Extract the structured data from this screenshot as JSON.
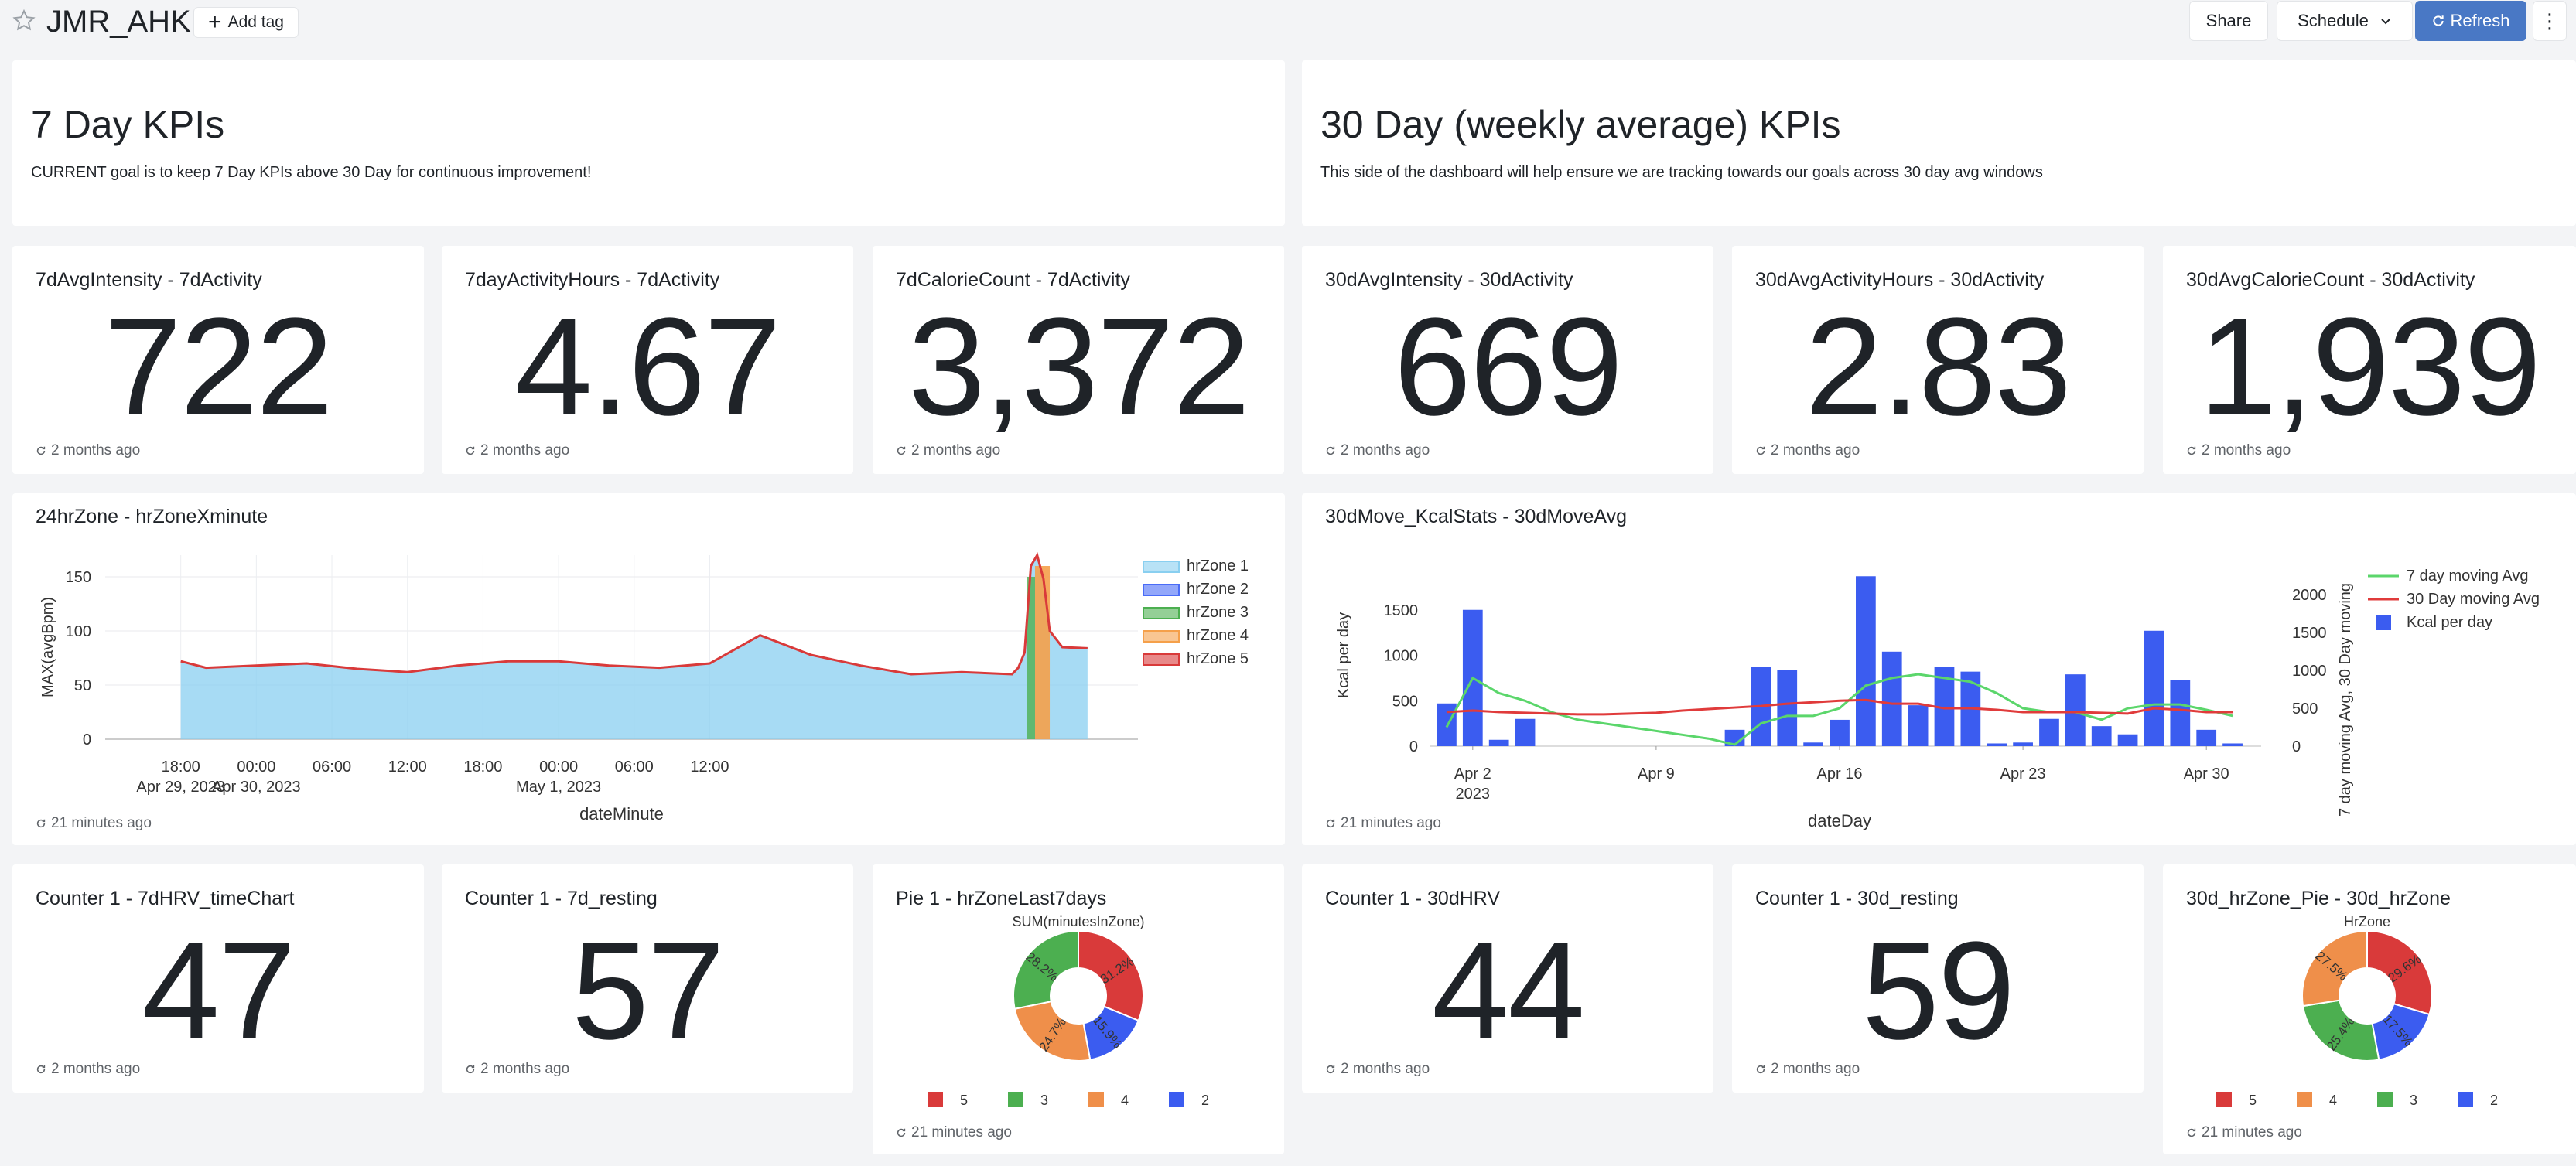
{
  "header": {
    "title": "JMR_AHK",
    "add_tag": "Add tag",
    "share": "Share",
    "schedule": "Schedule",
    "refresh": "Refresh"
  },
  "sections": [
    {
      "title": "7 Day KPIs",
      "subtitle": "CURRENT goal is to keep 7 Day KPIs above 30 Day for continuous improvement!"
    },
    {
      "title": "30 Day (weekly average) KPIs",
      "subtitle": "This side of the dashboard will help ensure we are tracking towards our goals across 30 day avg windows"
    }
  ],
  "counters_top": [
    {
      "title": "7dAvgIntensity - 7dActivity",
      "value": "722",
      "updated": "2 months ago"
    },
    {
      "title": "7dayActivityHours - 7dActivity",
      "value": "4.67",
      "updated": "2 months ago"
    },
    {
      "title": "7dCalorieCount - 7dActivity",
      "value": "3,372",
      "updated": "2 months ago"
    },
    {
      "title": "30dAvgIntensity - 30dActivity",
      "value": "669",
      "updated": "2 months ago"
    },
    {
      "title": "30dAvgActivityHours - 30dActivity",
      "value": "2.83",
      "updated": "2 months ago"
    },
    {
      "title": "30dAvgCalorieCount - 30dActivity",
      "value": "1,939",
      "updated": "2 months ago"
    }
  ],
  "counters_bottom": [
    {
      "title": "Counter 1 - 7dHRV_timeChart",
      "value": "47",
      "updated": "2 months ago"
    },
    {
      "title": "Counter 1 - 7d_resting",
      "value": "57",
      "updated": "2 months ago"
    },
    {
      "title": "Counter 1 - 30dHRV",
      "value": "44",
      "updated": "2 months ago"
    },
    {
      "title": "Counter 1 - 30d_resting",
      "value": "59",
      "updated": "2 months ago"
    }
  ],
  "chart_cards": [
    {
      "title": "24hrZone - hrZoneXminute",
      "updated": "21 minutes ago"
    },
    {
      "title": "30dMove_KcalStats - 30dMoveAvg",
      "updated": "21 minutes ago"
    },
    {
      "title": "Pie 1 - hrZoneLast7days",
      "updated": "21 minutes ago"
    },
    {
      "title": "30d_hrZone_Pie - 30d_hrZone",
      "updated": "21 minutes ago"
    }
  ],
  "chart_data": [
    {
      "type": "area",
      "xlabel": "dateMinute",
      "ylabel": "MAX(avgBpm)",
      "ylim": [
        0,
        170
      ],
      "yticks": [
        0,
        50,
        100,
        150
      ],
      "xtick_labels": [
        [
          "18:00",
          "Apr 29, 2023"
        ],
        [
          "00:00",
          "Apr 30, 2023"
        ],
        [
          "06:00"
        ],
        [
          "12:00"
        ],
        [
          "18:00"
        ],
        [
          "00:00",
          "May 1, 2023"
        ],
        [
          "06:00"
        ],
        [
          "12:00"
        ]
      ],
      "grid": true,
      "legend_position": "right",
      "series": [
        {
          "name": "hrZone 1",
          "color": "#89cff0",
          "x_hours": [
            0,
            2,
            6,
            10,
            14,
            18,
            22,
            26,
            30,
            34,
            38,
            42,
            46,
            50,
            54,
            58,
            62,
            66,
            66.5,
            67,
            67.5,
            68,
            68.5,
            69,
            70,
            72
          ],
          "values": [
            72,
            66,
            68,
            70,
            65,
            62,
            68,
            72,
            72,
            68,
            66,
            70,
            96,
            78,
            68,
            60,
            62,
            60,
            66,
            80,
            160,
            170,
            148,
            100,
            85,
            84
          ]
        },
        {
          "name": "hrZone 2",
          "color": "#4a6cf7",
          "values": []
        },
        {
          "name": "hrZone 3",
          "color": "#4caf50",
          "values": []
        },
        {
          "name": "hrZone 4",
          "color": "#f5a04a",
          "values": []
        },
        {
          "name": "hrZone 5",
          "color": "#d93a3a",
          "values": []
        }
      ]
    },
    {
      "type": "bar",
      "xlabel": "dateDay",
      "ylabel": "Kcal per day",
      "y2label": "7 day moving Avg, 30 Day moving",
      "ylim": [
        0,
        2000
      ],
      "yticks": [
        0,
        500,
        1000,
        1500
      ],
      "y2lim": [
        0,
        2400
      ],
      "y2ticks": [
        0,
        500,
        1000,
        1500,
        2000
      ],
      "xtick_labels": [
        [
          "Apr 2",
          "2023"
        ],
        [
          "Apr 9"
        ],
        [
          "Apr 16"
        ],
        [
          "Apr 23"
        ],
        [
          "Apr 30"
        ]
      ],
      "legend_position": "top-right",
      "categories": [
        "Apr 1",
        "Apr 2",
        "Apr 3",
        "Apr 4",
        "Apr 5",
        "Apr 6",
        "Apr 7",
        "Apr 8",
        "Apr 9",
        "Apr 10",
        "Apr 11",
        "Apr 12",
        "Apr 13",
        "Apr 14",
        "Apr 15",
        "Apr 16",
        "Apr 17",
        "Apr 18",
        "Apr 19",
        "Apr 20",
        "Apr 21",
        "Apr 22",
        "Apr 23",
        "Apr 24",
        "Apr 25",
        "Apr 26",
        "Apr 27",
        "Apr 28",
        "Apr 29",
        "Apr 30",
        "May 1"
      ],
      "series": [
        {
          "name": "Kcal per day",
          "color": "#3b5cf0",
          "kind": "bar",
          "values": [
            470,
            1500,
            70,
            300,
            0,
            0,
            0,
            0,
            0,
            0,
            0,
            180,
            870,
            840,
            40,
            290,
            1870,
            1040,
            450,
            870,
            820,
            30,
            40,
            300,
            790,
            220,
            130,
            1270,
            730,
            180,
            30
          ]
        },
        {
          "name": "7 day moving Avg",
          "color": "#5bd66b",
          "kind": "line",
          "values": [
            250,
            900,
            700,
            600,
            450,
            350,
            300,
            250,
            200,
            150,
            100,
            20,
            300,
            400,
            400,
            500,
            800,
            900,
            950,
            900,
            850,
            700,
            500,
            450,
            450,
            350,
            500,
            550,
            550,
            480,
            400
          ]
        },
        {
          "name": "30 Day moving Avg",
          "color": "#e03b3b",
          "kind": "line",
          "values": [
            450,
            470,
            450,
            440,
            430,
            420,
            420,
            430,
            440,
            470,
            490,
            510,
            530,
            560,
            580,
            600,
            610,
            560,
            560,
            500,
            500,
            480,
            450,
            450,
            450,
            440,
            430,
            500,
            480,
            450,
            450
          ]
        }
      ]
    },
    {
      "type": "pie",
      "title": "SUM(minutesInZone)",
      "categories": [
        "5",
        "2",
        "4",
        "3"
      ],
      "values": [
        31.2,
        15.9,
        24.7,
        28.2
      ],
      "labels": [
        "31.2%",
        "15.9%",
        "24.7%",
        "28.2%"
      ],
      "colors": [
        "#d93a3a",
        "#3b5cf0",
        "#ef8f4a",
        "#4caf50"
      ],
      "legend": [
        {
          "label": "5",
          "color": "#d93a3a"
        },
        {
          "label": "3",
          "color": "#4caf50"
        },
        {
          "label": "4",
          "color": "#ef8f4a"
        },
        {
          "label": "2",
          "color": "#3b5cf0"
        }
      ]
    },
    {
      "type": "pie",
      "title": "HrZone",
      "categories": [
        "5",
        "2",
        "3",
        "4"
      ],
      "values": [
        29.6,
        17.5,
        25.4,
        27.5
      ],
      "labels": [
        "29.6%",
        "17.5%",
        "25.4%",
        "27.5%"
      ],
      "colors": [
        "#d93a3a",
        "#3b5cf0",
        "#4caf50",
        "#ef8f4a"
      ],
      "legend": [
        {
          "label": "5",
          "color": "#d93a3a"
        },
        {
          "label": "4",
          "color": "#ef8f4a"
        },
        {
          "label": "3",
          "color": "#4caf50"
        },
        {
          "label": "2",
          "color": "#3b5cf0"
        }
      ]
    }
  ]
}
